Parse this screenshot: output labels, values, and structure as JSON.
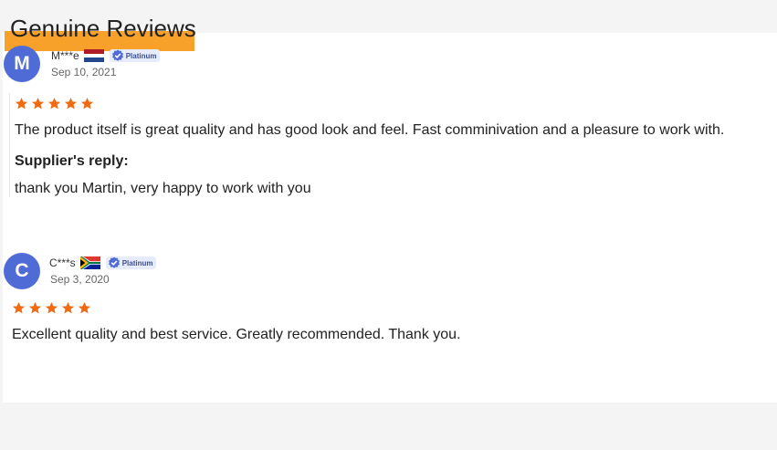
{
  "section_title": "Genuine Reviews",
  "colors": {
    "accent": "#f7a12b",
    "star": "#ef6a10",
    "avatar": "#4e6bd6"
  },
  "reviews": [
    {
      "initial": "M",
      "name": "M***e",
      "flag": "netherlands-flag",
      "badge": "Platinum",
      "date": "Sep 10, 2021",
      "rating": 5,
      "comment": "The product itself is great quality and has good look and feel. Fast comminivation and a pleasure to work with.",
      "reply_label": "Supplier's reply:",
      "reply": "thank you Martin, very happy to work with you"
    },
    {
      "initial": "C",
      "name": "C***s",
      "flag": "south-africa-flag",
      "badge": "Platinum",
      "date": "Sep 3, 2020",
      "rating": 5,
      "comment": "Excellent quality and best service. Greatly recommended. Thank you."
    }
  ]
}
